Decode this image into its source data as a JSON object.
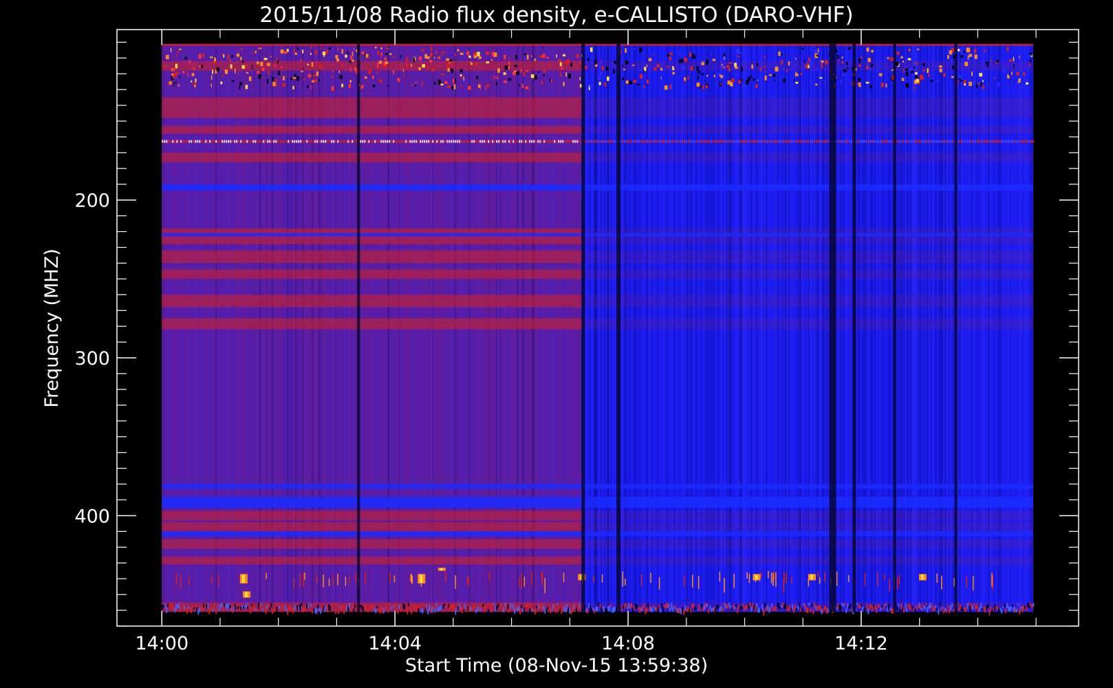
{
  "chart_data": {
    "type": "heatmap",
    "title": "2015/11/08  Radio flux density, e-CALLISTO (DARO-VHF)",
    "xlabel": "Start Time (08-Nov-15 13:59:38)",
    "ylabel": "Frequency (MHZ)",
    "x_unit": "minutes after 14:00",
    "xlim": [
      -0.77,
      15.73
    ],
    "ylim": [
      470,
      92
    ],
    "x_ticks": [
      {
        "value": 0,
        "label": "14:00"
      },
      {
        "value": 4,
        "label": "14:04"
      },
      {
        "value": 8,
        "label": "14:08"
      },
      {
        "value": 12,
        "label": "14:12"
      }
    ],
    "y_ticks": [
      {
        "value": 200,
        "label": "200"
      },
      {
        "value": 300,
        "label": "300"
      },
      {
        "value": 400,
        "label": "400"
      }
    ],
    "x_minor_step": 1,
    "y_minor_step": 10,
    "data_extent": {
      "time_start": 0,
      "time_end": 14.95,
      "freq_top": 101,
      "freq_bottom": 461
    },
    "regime_change_time": 7.2,
    "colors": {
      "background": "#000000",
      "axis": "#ffffff",
      "early_regime": "#5a1ea8",
      "late_regime": "#1c1cf0",
      "hot": "#d42020",
      "hotter": "#ff8a20",
      "hottest": "#ffe040",
      "dropout": "#05052e"
    },
    "bands_red": [
      {
        "from": 112,
        "to": 118
      },
      {
        "from": 135,
        "to": 148
      },
      {
        "from": 153,
        "to": 158
      },
      {
        "from": 170,
        "to": 176
      },
      {
        "from": 218,
        "to": 228
      },
      {
        "from": 232,
        "to": 240
      },
      {
        "from": 244,
        "to": 250
      },
      {
        "from": 260,
        "to": 268
      },
      {
        "from": 275,
        "to": 282
      },
      {
        "from": 397,
        "to": 403
      },
      {
        "from": 404,
        "to": 410
      },
      {
        "from": 415,
        "to": 421
      },
      {
        "from": 426,
        "to": 431
      },
      {
        "from": 455,
        "to": 461
      }
    ],
    "bands_blue": [
      {
        "from": 190,
        "to": 194
      },
      {
        "from": 221,
        "to": 223
      },
      {
        "from": 380,
        "to": 383
      },
      {
        "from": 388,
        "to": 395
      },
      {
        "from": 410,
        "to": 413
      }
    ],
    "dropouts_vertical": [
      {
        "t": 3.35,
        "w": 0.05
      },
      {
        "t": 7.2,
        "w": 0.06
      },
      {
        "t": 7.8,
        "w": 0.07
      },
      {
        "t": 11.45,
        "w": 0.12
      },
      {
        "t": 11.85,
        "w": 0.06
      },
      {
        "t": 12.55,
        "w": 0.05
      },
      {
        "t": 13.6,
        "w": 0.05
      }
    ],
    "hot_bursts": [
      {
        "t": 1.4,
        "f0": 437,
        "f1": 443
      },
      {
        "t": 1.45,
        "f0": 448,
        "f1": 452
      },
      {
        "t": 4.45,
        "f0": 437,
        "f1": 443
      },
      {
        "t": 4.8,
        "f0": 433,
        "f1": 435
      },
      {
        "t": 7.2,
        "f0": 437,
        "f1": 441
      },
      {
        "t": 10.2,
        "f0": 437,
        "f1": 441
      },
      {
        "t": 11.15,
        "f0": 437,
        "f1": 441
      },
      {
        "t": 13.05,
        "f0": 437,
        "f1": 441
      }
    ]
  }
}
